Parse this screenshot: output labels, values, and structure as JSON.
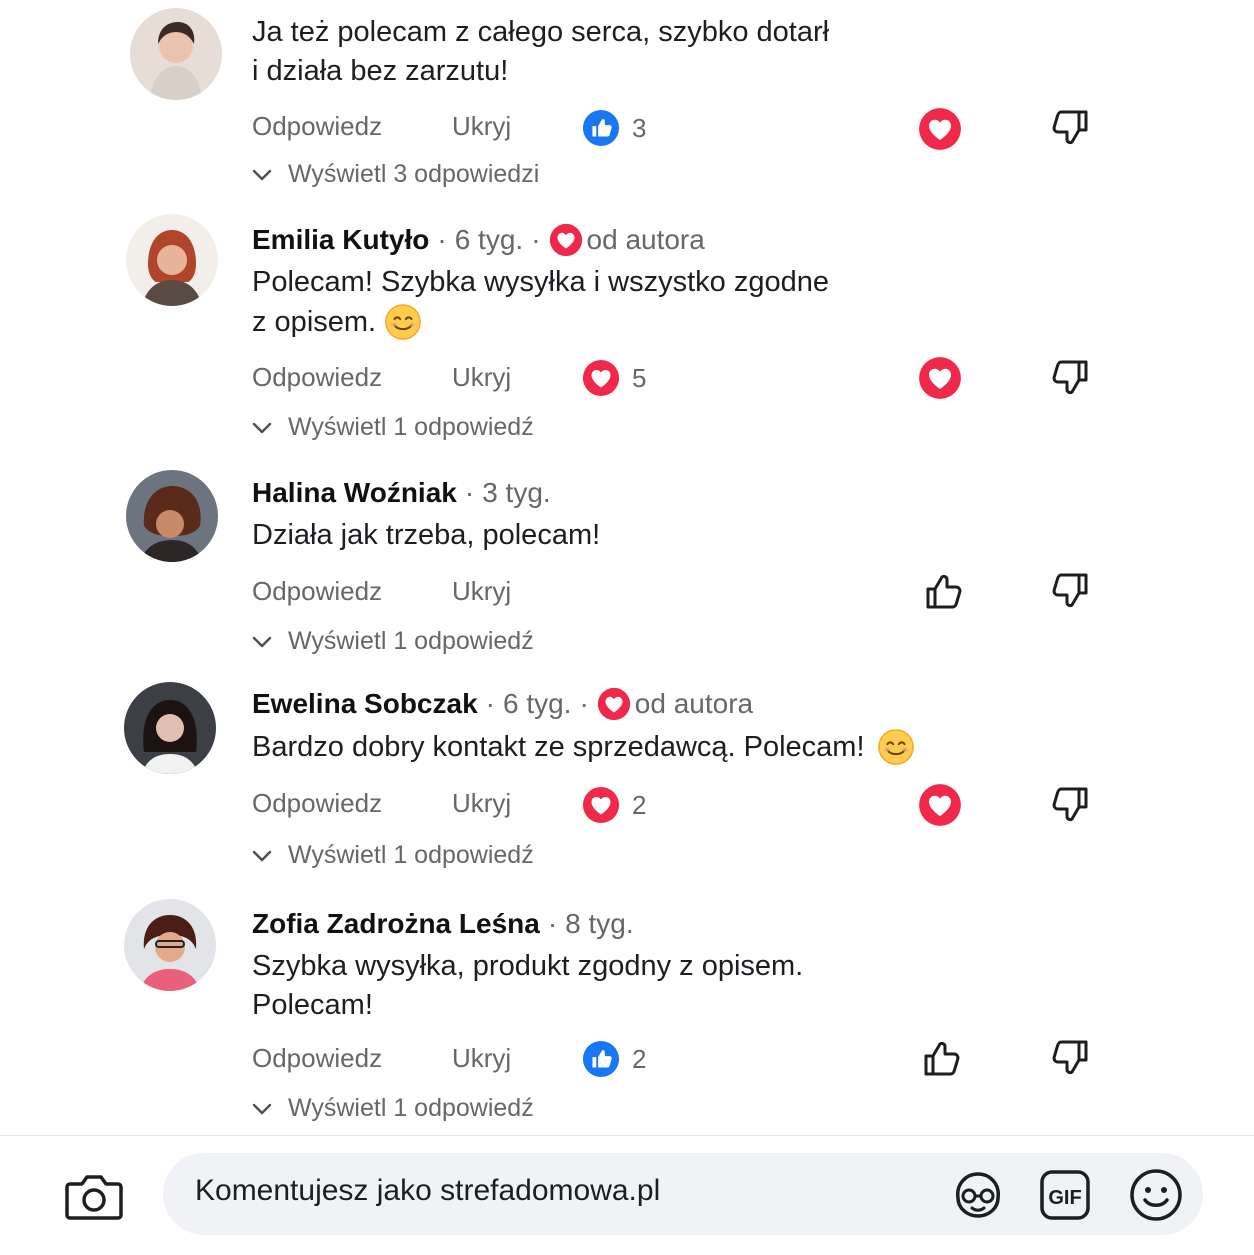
{
  "comments": [
    {
      "author": "",
      "time": "",
      "text_lines": [
        "Ja też polecam z całego serca, szybko dotarł",
        "i działa bez zarzutu!"
      ],
      "reply_label": "Odpowiedz",
      "hide_label": "Ukryj",
      "reaction": "like",
      "reaction_count": "3",
      "view_replies": "Wyświetl 3 odpowiedzi"
    },
    {
      "author": "Emilia Kutyło",
      "time": "6 tyg.",
      "author_badge": "od autora",
      "text_lines": [
        "Polecam! Szybka wysyłka i wszystko zgodne",
        "z opisem."
      ],
      "reply_label": "Odpowiedz",
      "hide_label": "Ukryj",
      "reaction": "love",
      "reaction_count": "5",
      "view_replies": "Wyświetl 1 odpowiedź"
    },
    {
      "author": "Halina Woźniak",
      "time": "3 tyg.",
      "text_lines": [
        "Działa jak trzeba, polecam!"
      ],
      "reply_label": "Odpowiedz",
      "hide_label": "Ukryj",
      "view_replies": "Wyświetl 1 odpowiedź"
    },
    {
      "author": "Ewelina Sobczak",
      "time": "6 tyg.",
      "author_badge": "od autora",
      "text_lines": [
        "Bardzo dobry kontakt ze sprzedawcą. Polecam!"
      ],
      "reply_label": "Odpowiedz",
      "hide_label": "Ukryj",
      "reaction": "love",
      "reaction_count": "2",
      "view_replies": "Wyświetl 1 odpowiedź"
    },
    {
      "author": "Zofia Zadrożna Leśna",
      "time": "8 tyg.",
      "text_lines": [
        "Szybka wysyłka, produkt zgodny z opisem.",
        "Polecam!"
      ],
      "reply_label": "Odpowiedz",
      "hide_label": "Ukryj",
      "reaction": "like",
      "reaction_count": "2",
      "view_replies": "Wyświetl 1 odpowiedź"
    }
  ],
  "composer": {
    "placeholder": "Komentujesz jako strefadomowa.pl"
  },
  "colors": {
    "like_blue": "#1877f2",
    "love_red": "#f0284a",
    "muted_text": "#65676b"
  },
  "icons": [
    "camera-icon",
    "avatar-sticker-icon",
    "gif-icon",
    "emoji-icon",
    "thumbs-up-outline-icon",
    "thumbs-down-outline-icon",
    "love-reaction-icon",
    "like-reaction-icon",
    "chevron-down-icon"
  ]
}
